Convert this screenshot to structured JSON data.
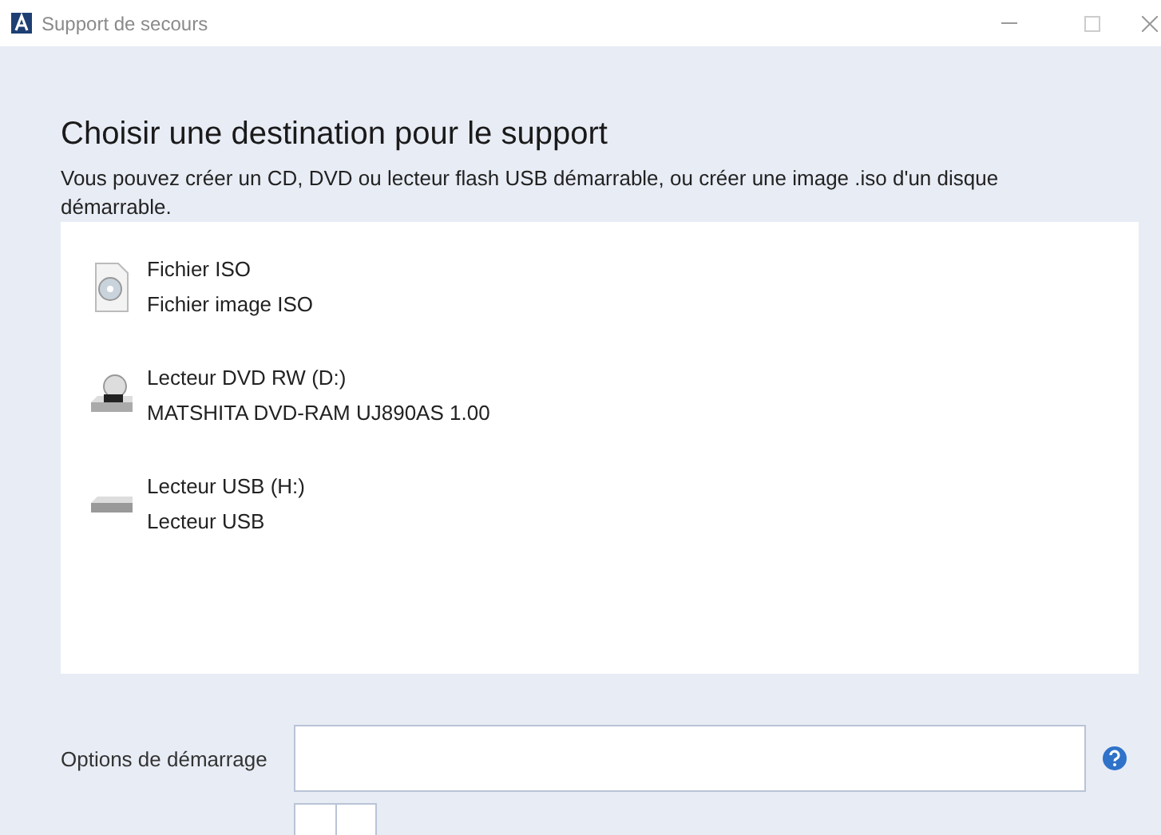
{
  "window": {
    "title": "Support de secours"
  },
  "heading": "Choisir une destination pour le support",
  "description": "Vous pouvez créer un CD, DVD ou lecteur flash USB démarrable, ou créer une image .iso d'un disque démarrable.",
  "destinations": [
    {
      "kind": "iso",
      "name": "Fichier ISO",
      "detail": "Fichier image ISO",
      "selected": false
    },
    {
      "kind": "dvd",
      "name": "Lecteur DVD RW (D:)",
      "detail": "MATSHITA DVD-RAM UJ890AS 1.00",
      "selected": false
    },
    {
      "kind": "usb",
      "name": "Lecteur USB (H:)",
      "detail": "Lecteur USB",
      "selected": false
    }
  ],
  "boot_options": {
    "label": "Options de démarrage"
  }
}
